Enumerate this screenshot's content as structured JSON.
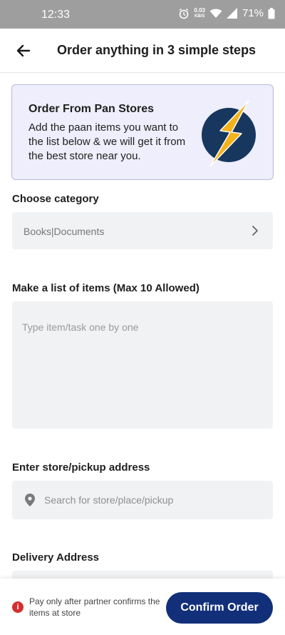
{
  "status_bar": {
    "time": "12:33",
    "net_speed_value": "0.03",
    "net_speed_unit": "KB/S",
    "battery": "71%",
    "icons": [
      "alarm-icon",
      "wifi-icon",
      "signal-icon",
      "battery-icon"
    ]
  },
  "header": {
    "title": "Order anything in 3 simple steps",
    "back_icon": "arrow-left-icon"
  },
  "promo": {
    "title": "Order From Pan Stores",
    "text": "Add the paan items you want to the list below & we will get it from the best store near you.",
    "icon": "lightning-bolt-icon"
  },
  "category": {
    "label": "Choose category",
    "value": "Books|Documents"
  },
  "items": {
    "label": "Make a list of items (Max 10 Allowed)",
    "placeholder": "Type item/task one by one"
  },
  "pickup": {
    "label": "Enter store/pickup address",
    "placeholder": "Search for store/place/pickup"
  },
  "delivery": {
    "label": "Delivery Address"
  },
  "footer": {
    "note": "Pay only after partner confirms the items at store",
    "confirm_label": "Confirm Order"
  },
  "colors": {
    "primary": "#12307a",
    "promo_bg": "#eeeefc",
    "bolt_circle": "#17375e",
    "bolt": "#f5b21b",
    "alert": "#d32f2f"
  }
}
